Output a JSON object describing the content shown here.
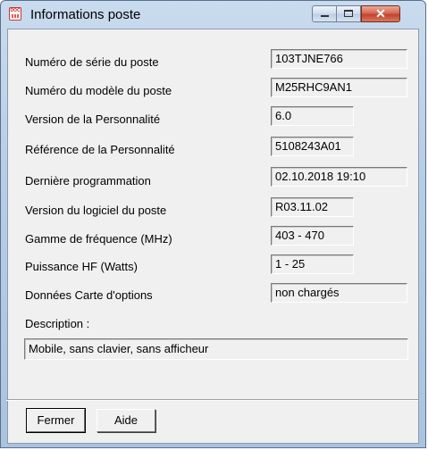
{
  "window": {
    "title": "Informations poste",
    "app_icon_text": "DOC",
    "controls": {
      "minimize_icon": "minimize-icon",
      "maximize_icon": "maximize-icon",
      "close_icon": "close-icon",
      "close_glyph": "✕"
    }
  },
  "fields": [
    {
      "label": "Numéro de série du poste",
      "value": "103TJNE766"
    },
    {
      "label": "Numéro du modèle du poste",
      "value": "M25RHC9AN1"
    },
    {
      "label": "Version de la Personnalité",
      "value": "6.0"
    },
    {
      "label": "Référence de la Personnalité",
      "value": "5108243A01"
    },
    {
      "label": "Dernière programmation",
      "value": "02.10.2018 19:10"
    },
    {
      "label": "Version du logiciel du poste",
      "value": "R03.11.02"
    },
    {
      "label": "Gamme de fréquence (MHz)",
      "value": "403 - 470"
    },
    {
      "label": "Puissance HF (Watts)",
      "value": "1 - 25"
    },
    {
      "label": "Données Carte d'options",
      "value": "non chargés"
    }
  ],
  "description": {
    "label": "Description :",
    "value": "Mobile, sans clavier, sans afficheur"
  },
  "buttons": {
    "close_label": "Fermer",
    "help_label": "Aide"
  },
  "colors": {
    "titlebar": "#b7cde6",
    "client_bg": "#f0f0f0",
    "close_button": "#c2432a"
  }
}
